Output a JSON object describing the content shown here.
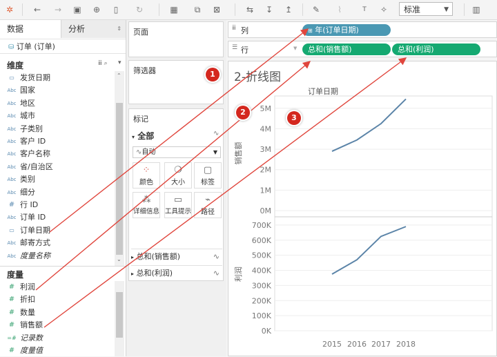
{
  "toolbar": {
    "view_size": "标准"
  },
  "left": {
    "tab_data": "数据",
    "tab_analysis": "分析",
    "datasource": "订单 (订单)",
    "dimensions_title": "维度",
    "dimensions": [
      {
        "label": "发货日期",
        "icon": "date"
      },
      {
        "label": "国家",
        "icon": "Abc"
      },
      {
        "label": "地区",
        "icon": "Abc"
      },
      {
        "label": "城市",
        "icon": "Abc"
      },
      {
        "label": "子类别",
        "icon": "Abc"
      },
      {
        "label": "客户 ID",
        "icon": "Abc"
      },
      {
        "label": "客户名称",
        "icon": "Abc"
      },
      {
        "label": "省/自治区",
        "icon": "Abc"
      },
      {
        "label": "类别",
        "icon": "Abc"
      },
      {
        "label": "细分",
        "icon": "Abc"
      },
      {
        "label": "行 ID",
        "icon": "#"
      },
      {
        "label": "订单 ID",
        "icon": "Abc"
      },
      {
        "label": "订单日期",
        "icon": "date"
      },
      {
        "label": "邮寄方式",
        "icon": "Abc"
      },
      {
        "label": "度量名称",
        "icon": "Abc",
        "italic": true
      }
    ],
    "measures_title": "度量",
    "measures": [
      {
        "label": "利润",
        "icon": "#"
      },
      {
        "label": "折扣",
        "icon": "#"
      },
      {
        "label": "数量",
        "icon": "#"
      },
      {
        "label": "销售额",
        "icon": "#"
      },
      {
        "label": "记录数",
        "icon": "=#",
        "italic": true
      },
      {
        "label": "度量值",
        "icon": "#",
        "italic": true
      }
    ]
  },
  "cards": {
    "pages": "页面",
    "filters": "筛选器",
    "marks": "标记",
    "marks_all": "全部",
    "mark_type": "自动",
    "mark_buttons": [
      "颜色",
      "大小",
      "标签",
      "详细信息",
      "工具提示",
      "路径"
    ],
    "marks_measures": [
      "总和(销售额)",
      "总和(利润)"
    ]
  },
  "shelves": {
    "columns_label": "列",
    "rows_label": "行",
    "columns_pill": "年(订单日期)",
    "rows_pills": [
      "总和(销售额)",
      "总和(利润)"
    ]
  },
  "badges": [
    "1",
    "2",
    "3"
  ],
  "view": {
    "sheet_title": "2-折线图"
  },
  "chart_data": {
    "type": "line",
    "title": "订单日期",
    "categories": [
      "2015",
      "2016",
      "2017",
      "2018"
    ],
    "panes": [
      {
        "ylabel": "销售额",
        "ylim": [
          0,
          5600000
        ],
        "ticks": [
          0,
          1000000,
          2000000,
          3000000,
          4000000,
          5000000
        ],
        "tick_labels": [
          "0M",
          "1M",
          "2M",
          "3M",
          "4M",
          "5M"
        ],
        "values": [
          2900000,
          3450000,
          4250000,
          5450000
        ]
      },
      {
        "ylabel": "利润",
        "ylim": [
          0,
          750000
        ],
        "ticks": [
          0,
          100000,
          200000,
          300000,
          400000,
          500000,
          600000,
          700000
        ],
        "tick_labels": [
          "0K",
          "100K",
          "200K",
          "300K",
          "400K",
          "500K",
          "600K",
          "700K"
        ],
        "values": [
          375000,
          470000,
          625000,
          690000
        ]
      }
    ],
    "line_color": "#5b84a8",
    "grid": true
  }
}
